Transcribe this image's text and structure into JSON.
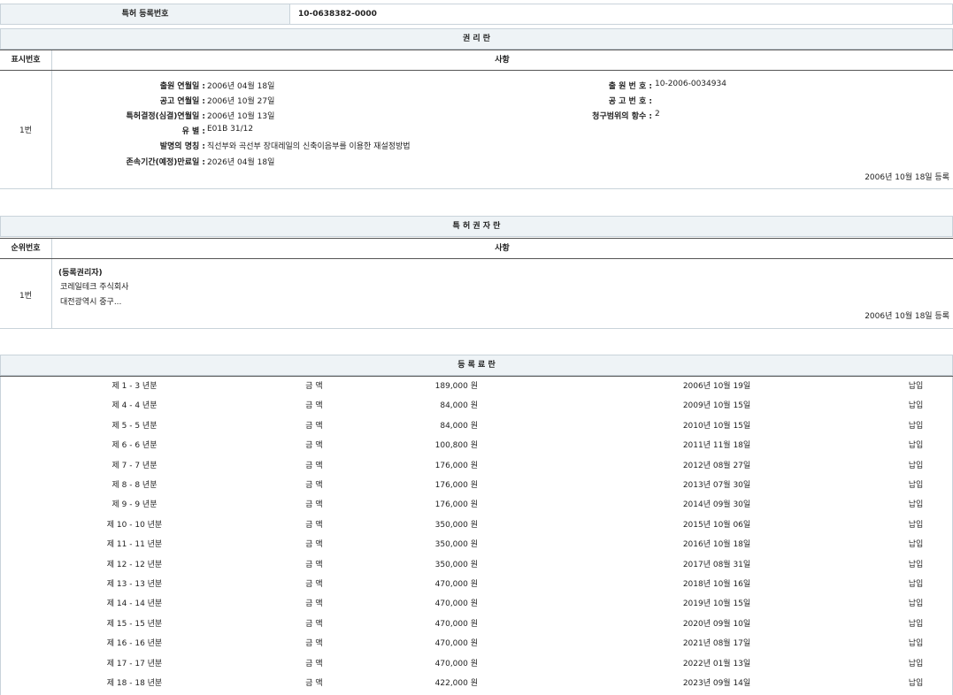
{
  "header": {
    "label": "특허 등록번호",
    "number": "10-0638382-0000"
  },
  "rights": {
    "title": "권 리 란",
    "col_num": "표시번호",
    "col_matter": "사항",
    "row_num": "1번",
    "filing_date_label": "출원 연월일 :",
    "filing_date": "2006년 04월 18일",
    "pub_date_label": "공고 연월일 :",
    "pub_date": "2006년 10월 27일",
    "decision_date_label": "특허결정(심결)연월일 :",
    "decision_date": "2006년 10월 13일",
    "class_label": "유 별 :",
    "class_value": "E01B 31/12",
    "invention_label": "발명의 명칭 :",
    "invention_value": "직선부와 곡선부 장대레일의 신축이음부를 이용한 재설정방법",
    "expiry_label": "존속기간(예정)만료일 :",
    "expiry_value": "2026년 04월 18일",
    "app_no_label": "출 원 번 호 :",
    "app_no_value": "10-2006-0034934",
    "pub_no_label": "공 고 번 호 :",
    "pub_no_value": "",
    "claims_label": "청구범위의 항수 :",
    "claims_value": "2",
    "stamp": "2006년 10월 18일 등록"
  },
  "owners": {
    "title": "특 허 권 자 란",
    "col_num": "순위번호",
    "col_matter": "사항",
    "row_num": "1번",
    "role": "(등록권리자)",
    "name": "코레일테크 주식회사",
    "address": "대전광역시 중구...",
    "stamp": "2006년 10월 18일 등록"
  },
  "fees": {
    "title": "등 록 료 란",
    "rows": [
      {
        "period": "제 1 - 3 년분",
        "label": "금 액",
        "amount": "189,000 원",
        "date": "2006년 10월 19일",
        "status": "납입"
      },
      {
        "period": "제 4 - 4 년분",
        "label": "금 액",
        "amount": "84,000 원",
        "date": "2009년 10월 15일",
        "status": "납입"
      },
      {
        "period": "제 5 - 5 년분",
        "label": "금 액",
        "amount": "84,000 원",
        "date": "2010년 10월 15일",
        "status": "납입"
      },
      {
        "period": "제 6 - 6 년분",
        "label": "금 액",
        "amount": "100,800 원",
        "date": "2011년 11월 18일",
        "status": "납입"
      },
      {
        "period": "제 7 - 7 년분",
        "label": "금 액",
        "amount": "176,000 원",
        "date": "2012년 08월 27일",
        "status": "납입"
      },
      {
        "period": "제 8 - 8 년분",
        "label": "금 액",
        "amount": "176,000 원",
        "date": "2013년 07월 30일",
        "status": "납입"
      },
      {
        "period": "제 9 - 9 년분",
        "label": "금 액",
        "amount": "176,000 원",
        "date": "2014년 09월 30일",
        "status": "납입"
      },
      {
        "period": "제 10 - 10 년분",
        "label": "금 액",
        "amount": "350,000 원",
        "date": "2015년 10월 06일",
        "status": "납입"
      },
      {
        "period": "제 11 - 11 년분",
        "label": "금 액",
        "amount": "350,000 원",
        "date": "2016년 10월 18일",
        "status": "납입"
      },
      {
        "period": "제 12 - 12 년분",
        "label": "금 액",
        "amount": "350,000 원",
        "date": "2017년 08월 31일",
        "status": "납입"
      },
      {
        "period": "제 13 - 13 년분",
        "label": "금 액",
        "amount": "470,000 원",
        "date": "2018년 10월 16일",
        "status": "납입"
      },
      {
        "period": "제 14 - 14 년분",
        "label": "금 액",
        "amount": "470,000 원",
        "date": "2019년 10월 15일",
        "status": "납입"
      },
      {
        "period": "제 15 - 15 년분",
        "label": "금 액",
        "amount": "470,000 원",
        "date": "2020년 09월 10일",
        "status": "납입"
      },
      {
        "period": "제 16 - 16 년분",
        "label": "금 액",
        "amount": "470,000 원",
        "date": "2021년 08월 17일",
        "status": "납입"
      },
      {
        "period": "제 17 - 17 년분",
        "label": "금 액",
        "amount": "470,000 원",
        "date": "2022년 01월 13일",
        "status": "납입"
      },
      {
        "period": "제 18 - 18 년분",
        "label": "금 액",
        "amount": "422,000 원",
        "date": "2023년 09월 14일",
        "status": "납입"
      }
    ]
  }
}
